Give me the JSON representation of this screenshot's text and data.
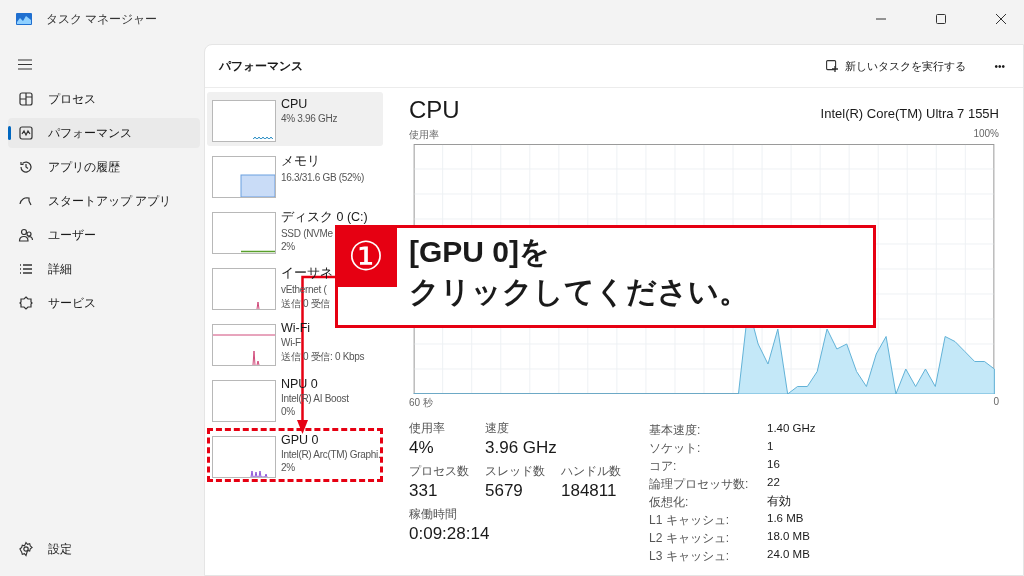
{
  "window": {
    "title": "タスク マネージャー"
  },
  "nav": {
    "items": [
      {
        "label": "プロセス",
        "kind": "processes",
        "selected": false
      },
      {
        "label": "パフォーマンス",
        "kind": "performance",
        "selected": true
      },
      {
        "label": "アプリの履歴",
        "kind": "history",
        "selected": false
      },
      {
        "label": "スタートアップ アプリ",
        "kind": "startup",
        "selected": false
      },
      {
        "label": "ユーザー",
        "kind": "users",
        "selected": false
      },
      {
        "label": "詳細",
        "kind": "details",
        "selected": false
      },
      {
        "label": "サービス",
        "kind": "services",
        "selected": false
      }
    ],
    "settings": "設定"
  },
  "header": {
    "title": "パフォーマンス",
    "run_task": "新しいタスクを実行する",
    "more": "•••"
  },
  "devices": [
    {
      "name": "CPU",
      "lines": [
        "4%  3.96 GHz"
      ],
      "kind": "cpu",
      "selected": true,
      "highlighted": false
    },
    {
      "name": "メモリ",
      "lines": [
        "16.3/31.6 GB (52%)"
      ],
      "kind": "memory",
      "selected": false,
      "highlighted": false
    },
    {
      "name": "ディスク 0 (C:)",
      "lines": [
        "SSD (NVMe",
        "2%"
      ],
      "kind": "disk",
      "selected": false,
      "highlighted": false
    },
    {
      "name": "イーサネ",
      "lines": [
        "vEthernet (",
        "送信 0 受信"
      ],
      "kind": "ethernet",
      "selected": false,
      "highlighted": false
    },
    {
      "name": "Wi-Fi",
      "lines": [
        "Wi-F",
        "送信 0 受信: 0 Kbps"
      ],
      "kind": "wifi",
      "selected": false,
      "highlighted": false
    },
    {
      "name": "NPU 0",
      "lines": [
        "Intel(R) AI Boost",
        "0%"
      ],
      "kind": "npu",
      "selected": false,
      "highlighted": false
    },
    {
      "name": "GPU 0",
      "lines": [
        "Intel(R) Arc(TM) Graphi.",
        "2%"
      ],
      "kind": "gpu",
      "selected": false,
      "highlighted": true
    }
  ],
  "detail": {
    "title": "CPU",
    "model": "Intel(R) Core(TM) Ultra 7 155H",
    "graph_label": "使用率",
    "graph_max": "100%",
    "graph_start": "60 秒",
    "graph_end": "0",
    "stats": [
      {
        "label": "使用率",
        "value": "4%"
      },
      {
        "label": "速度",
        "value": "3.96 GHz"
      }
    ],
    "counts": [
      {
        "label": "プロセス数",
        "value": "331"
      },
      {
        "label": "スレッド数",
        "value": "5679"
      },
      {
        "label": "ハンドル数",
        "value": "184811"
      }
    ],
    "uptime": {
      "label": "稼働時間",
      "value": "0:09:28:14"
    },
    "specs": [
      {
        "label": "基本速度:",
        "value": "1.40 GHz"
      },
      {
        "label": "ソケット:",
        "value": "1"
      },
      {
        "label": "コア:",
        "value": "16"
      },
      {
        "label": "論理プロセッサ数:",
        "value": "22"
      },
      {
        "label": "仮想化:",
        "value": "有効"
      },
      {
        "label": "L1 キャッシュ:",
        "value": "1.6 MB"
      },
      {
        "label": "L2 キャッシュ:",
        "value": "18.0 MB"
      },
      {
        "label": "L3 キャッシュ:",
        "value": "24.0 MB"
      }
    ]
  },
  "annotation": {
    "step": "①",
    "lines": [
      "[GPU 0]を",
      "クリックしてください。"
    ]
  }
}
